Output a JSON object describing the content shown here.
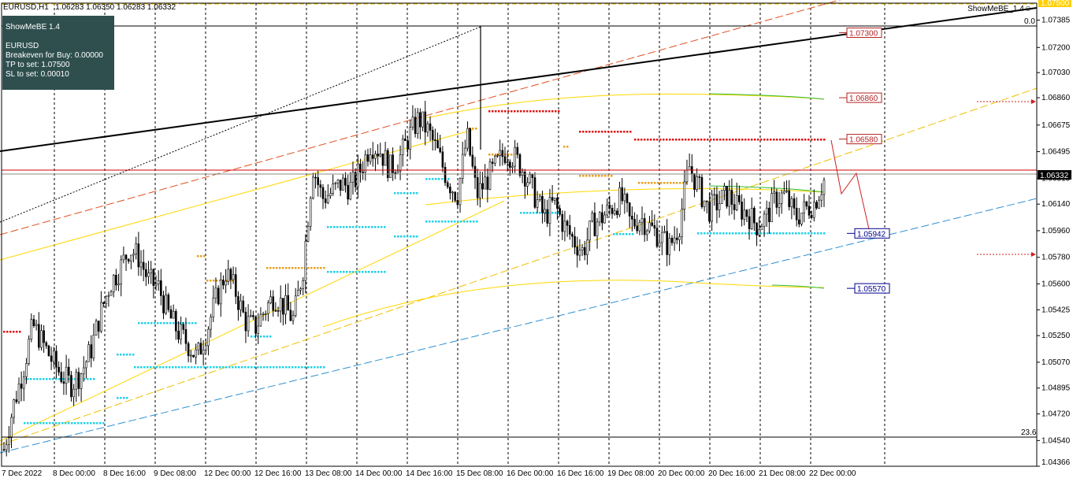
{
  "title_bar": {
    "symbol_tf": "EURUSD,H1",
    "ohlc": "1.06283 1.06350 1.06283 1.06332"
  },
  "indicator_name": "ShowMeBE_1.4",
  "info_panel": {
    "line1": "ShowMeBE 1.4",
    "line2": "",
    "line3": "EURUSD",
    "line4": "Breakeven for Buy: 0.00000",
    "line5": "TP to set: 1.07500",
    "line6": "SL to set: 0.00010"
  },
  "current_price_label": "1.06332",
  "top_tag_label": "1.07500",
  "corner_labels": {
    "top_right": "0.0",
    "bottom_right": "23.6"
  },
  "price_axis": {
    "min": 1.04366,
    "max": 1.075,
    "ticks": [
      "1.07385",
      "1.07200",
      "1.07030",
      "1.06860",
      "1.06675",
      "1.06495",
      "1.06315",
      "1.06140",
      "1.05960",
      "1.05780",
      "1.05600",
      "1.05425",
      "1.05250",
      "1.05070",
      "1.04895",
      "1.04720",
      "1.04540",
      "1.04366"
    ]
  },
  "time_axis": {
    "labels": [
      "7 Dec 2022",
      "8 Dec 00:00",
      "8 Dec 16:00",
      "9 Dec 08:00",
      "12 Dec 00:00",
      "12 Dec 16:00",
      "13 Dec 08:00",
      "14 Dec 00:00",
      "14 Dec 16:00",
      "15 Dec 08:00",
      "16 Dec 00:00",
      "16 Dec 16:00",
      "19 Dec 08:00",
      "20 Dec 00:00",
      "20 Dec 16:00",
      "21 Dec 08:00",
      "22 Dec 00:00"
    ]
  },
  "level_tags": [
    {
      "label": "1.07300",
      "price": 1.073,
      "color": "#b22222"
    },
    {
      "label": "1.06860",
      "price": 1.0686,
      "color": "#b22222"
    },
    {
      "label": "1.06580",
      "price": 1.0658,
      "color": "#b22222"
    },
    {
      "label": "1.05942",
      "price": 1.05942,
      "color": "#00008b"
    },
    {
      "label": "1.05570",
      "price": 1.0557,
      "color": "#00008b"
    }
  ],
  "colors": {
    "bull_bear": "#000000",
    "grid": "#000000",
    "support_dots": "#1fd1e8",
    "resistance_dots": "#dd1111",
    "mid_dots": "#e8a020",
    "regression": "#ffd700",
    "trend_red": "#e05020",
    "trend_blue": "#3090d0",
    "trend_black": "#000000",
    "envelope_green": "#33bb33",
    "price_line": "#cc0000"
  },
  "chart_data": {
    "type": "candlestick",
    "symbol": "EURUSD",
    "timeframe": "H1",
    "ylim": [
      1.04366,
      1.075
    ],
    "close_path": [
      1.0448,
      1.0478,
      1.0502,
      1.0532,
      1.052,
      1.0508,
      1.0498,
      1.0492,
      1.05,
      1.0515,
      1.054,
      1.056,
      1.057,
      1.0584,
      1.0578,
      1.0562,
      1.0558,
      1.054,
      1.0528,
      1.052,
      1.051,
      1.0528,
      1.055,
      1.0568,
      1.0555,
      1.0535,
      1.053,
      1.0542,
      1.0552,
      1.0545,
      1.0536,
      1.057,
      1.064,
      1.0618,
      1.0622,
      1.0628,
      1.0625,
      1.0638,
      1.0655,
      1.065,
      1.0638,
      1.0645,
      1.066,
      1.0672,
      1.0663,
      1.0648,
      1.063,
      1.062,
      1.066,
      1.062,
      1.063,
      1.064,
      1.065,
      1.0645,
      1.0635,
      1.062,
      1.0605,
      1.0615,
      1.06,
      1.059,
      1.0582,
      1.06,
      1.0605,
      1.0612,
      1.0618,
      1.06,
      1.0605,
      1.0598,
      1.0592,
      1.0585,
      1.06,
      1.064,
      1.0625,
      1.061,
      1.0615,
      1.062,
      1.0612,
      1.0608,
      1.06,
      1.0605,
      1.0618,
      1.062,
      1.0605,
      1.061,
      1.0615,
      1.063
    ]
  }
}
